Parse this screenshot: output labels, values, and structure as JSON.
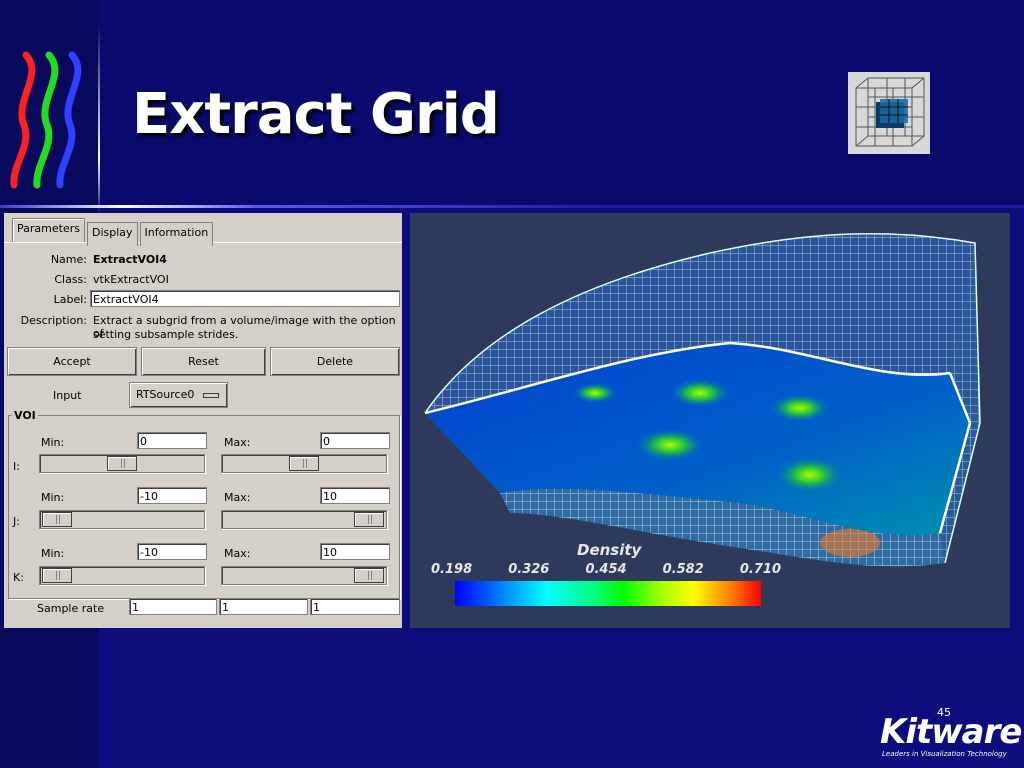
{
  "slide": {
    "title": "Extract Grid",
    "page_number": "45",
    "brand": "Kitware",
    "tagline": "Leaders in Visualization Technology"
  },
  "panel": {
    "tabs": [
      "Parameters",
      "Display",
      "Information"
    ],
    "active_tab": "Parameters",
    "name_label": "Name:",
    "name_value": "ExtractVOI4",
    "class_label": "Class:",
    "class_value": "vtkExtractVOI",
    "label_label": "Label:",
    "label_value": "ExtractVOI4",
    "description_label": "Description:",
    "description_line1": "Extract a subgrid from a volume/image with the option of",
    "description_line2": "setting subsample strides.",
    "accept": "Accept",
    "reset": "Reset",
    "delete": "Delete",
    "input_label": "Input",
    "input_value": "RTSource0",
    "voi_title": "VOI",
    "voi": {
      "i": {
        "axis": "I:",
        "min_label": "Min:",
        "min": "0",
        "max_label": "Max:",
        "max": "0",
        "min_pos": 0.5,
        "max_pos": 0.5
      },
      "j": {
        "axis": "J:",
        "min_label": "Min:",
        "min": "-10",
        "max_label": "Max:",
        "max": "10",
        "min_pos": 0.0,
        "max_pos": 1.0
      },
      "k": {
        "axis": "K:",
        "min_label": "Min:",
        "min": "-10",
        "max_label": "Max:",
        "max": "10",
        "min_pos": 0.0,
        "max_pos": 1.0
      }
    },
    "sample_rate_label": "Sample rate",
    "sample_rate": [
      "1",
      "1",
      "1"
    ]
  },
  "legend": {
    "title": "Density",
    "ticks": [
      "0.198",
      "0.326",
      "0.454",
      "0.582",
      "0.710"
    ]
  },
  "colors": {
    "background": "#0c0c7c",
    "panel": "#d4d0c8",
    "viz_background": "#2e3a5c"
  }
}
